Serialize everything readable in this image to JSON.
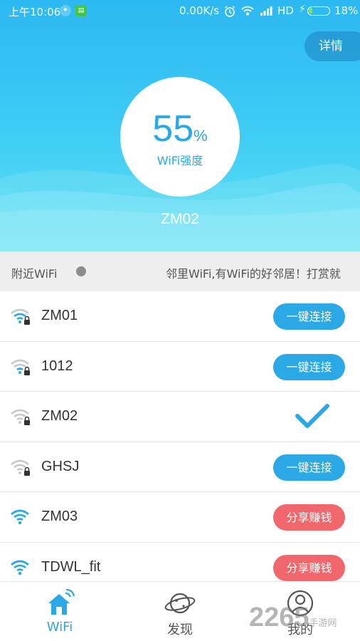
{
  "status_bar": {
    "time": "上午10:06",
    "net_speed": "0.00K/s",
    "network": "HD",
    "battery_percent": "18%",
    "battery_level": 0.18,
    "icons": [
      "vpn-icon",
      "app-notification-icon",
      "alarm-icon",
      "wifi-icon",
      "signal-icon",
      "charging-icon",
      "battery-icon"
    ]
  },
  "header": {
    "detail_button": "详情",
    "strength_value": "55",
    "strength_unit": "%",
    "strength_label": "WiFi强度",
    "connected_ssid": "ZM02",
    "colors": {
      "gradient_top": "#2cb8f2",
      "gradient_bottom": "#63e3f3"
    }
  },
  "nearby": {
    "label": "附近WiFi",
    "marquee_text": "邻里WiFi,有WiFi的好邻居！打赏就"
  },
  "networks": [
    {
      "name": "ZM01",
      "icon": "wifi-locked-icon",
      "action": "一键连接",
      "action_type": "connect"
    },
    {
      "name": "1012",
      "icon": "wifi-locked-icon",
      "action": "一键连接",
      "action_type": "connect"
    },
    {
      "name": "ZM02",
      "icon": "wifi-locked-icon",
      "action": "",
      "action_type": "connected"
    },
    {
      "name": "GHSJ",
      "icon": "wifi-locked-icon",
      "action": "一键连接",
      "action_type": "connect"
    },
    {
      "name": "ZM03",
      "icon": "wifi-icon",
      "action": "分享赚钱",
      "action_type": "share"
    },
    {
      "name": "TDWL_fit",
      "icon": "wifi-icon",
      "action": "分享赚钱",
      "action_type": "share"
    }
  ],
  "tabs": [
    {
      "label": "WiFi",
      "icon": "home-wifi-icon",
      "active": true
    },
    {
      "label": "发现",
      "icon": "planet-icon",
      "active": false
    },
    {
      "label": "我的",
      "icon": "user-icon",
      "active": false
    }
  ],
  "watermark": {
    "main": "2265",
    "sub": "手游网"
  },
  "colors": {
    "accent": "#2aa9e6",
    "share": "#f2676b",
    "divider": "#e4e4e4"
  }
}
